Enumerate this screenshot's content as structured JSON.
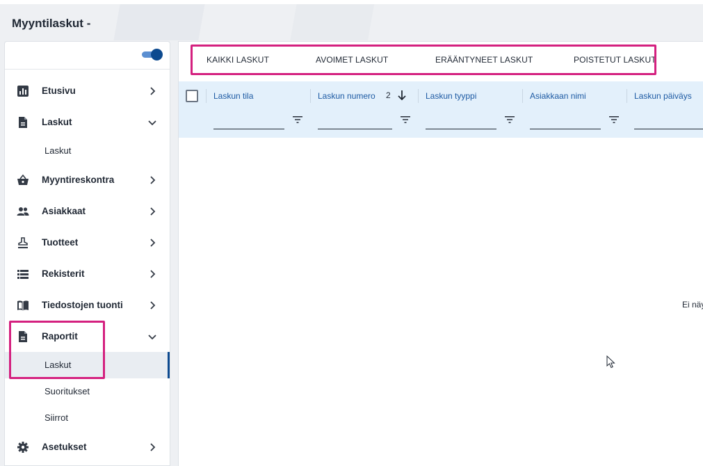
{
  "header": {
    "title": "Myyntilaskut -"
  },
  "sidebar": {
    "items": [
      {
        "label": "Etusivu",
        "icon": "bar-chart-icon"
      },
      {
        "label": "Laskut",
        "icon": "document-icon",
        "expanded": true,
        "sub": [
          "Laskut"
        ]
      },
      {
        "label": "Myyntireskontra",
        "icon": "basket-icon"
      },
      {
        "label": "Asiakkaat",
        "icon": "people-icon"
      },
      {
        "label": "Tuotteet",
        "icon": "stamp-icon"
      },
      {
        "label": "Rekisterit",
        "icon": "list-icon"
      },
      {
        "label": "Tiedostojen tuonti",
        "icon": "book-icon"
      },
      {
        "label": "Raportit",
        "icon": "document-icon",
        "expanded": true,
        "sub": [
          "Laskut",
          "Suoritukset",
          "Siirrot"
        ],
        "active_sub": "Laskut"
      },
      {
        "label": "Asetukset",
        "icon": "gear-icon"
      }
    ]
  },
  "tabs": [
    "KAIKKI LASKUT",
    "AVOIMET LASKUT",
    "ERÄÄNTYNEET LASKUT",
    "POISTETUT LASKUT"
  ],
  "grid": {
    "columns": [
      "Laskun tila",
      "Laskun numero",
      "Laskun tyyppi",
      "Asiakkaan nimi",
      "Laskun päiväys"
    ],
    "sort": {
      "column": "Laskun numero",
      "order": "2",
      "direction": "descending"
    },
    "empty_text": "Ei näy"
  },
  "colors": {
    "accent": "#0d4a8f",
    "highlight": "#d4207f",
    "grid_header": "#e3f0fb",
    "column_title": "#1d5aa3"
  }
}
